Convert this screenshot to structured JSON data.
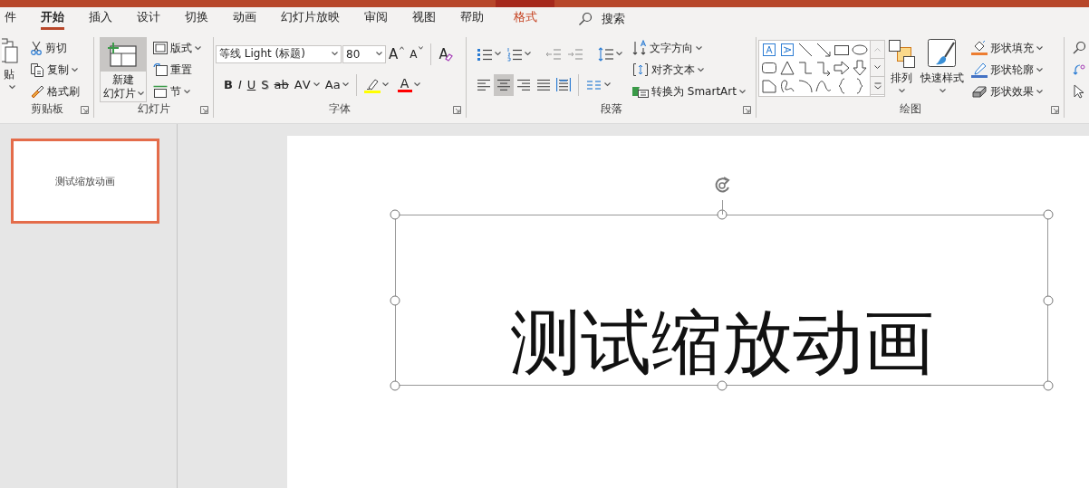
{
  "tabs": [
    {
      "label": "件",
      "selected": false,
      "kind": "standard"
    },
    {
      "label": "开始",
      "selected": true,
      "kind": "standard"
    },
    {
      "label": "插入",
      "selected": false,
      "kind": "standard"
    },
    {
      "label": "设计",
      "selected": false,
      "kind": "standard"
    },
    {
      "label": "切换",
      "selected": false,
      "kind": "standard"
    },
    {
      "label": "动画",
      "selected": false,
      "kind": "standard"
    },
    {
      "label": "幻灯片放映",
      "selected": false,
      "kind": "standard"
    },
    {
      "label": "审阅",
      "selected": false,
      "kind": "standard"
    },
    {
      "label": "视图",
      "selected": false,
      "kind": "standard"
    },
    {
      "label": "帮助",
      "selected": false,
      "kind": "standard"
    },
    {
      "label": "格式",
      "selected": false,
      "kind": "contextual"
    }
  ],
  "search": {
    "label": "搜索"
  },
  "ribbon": {
    "clipboard": {
      "title": "剪贴板",
      "paste": "贴",
      "cut": "剪切",
      "copy": "复制",
      "format_painter": "格式刷"
    },
    "slides": {
      "title": "幻灯片",
      "new_slide": [
        "新建",
        "幻灯片"
      ],
      "layout": "版式",
      "reset": "重置",
      "section": "节"
    },
    "font": {
      "title": "字体",
      "font_name": "等线 Light (标题)",
      "font_size": "80",
      "grow": "A",
      "shrink": "A",
      "clear": "A",
      "styles": [
        "B",
        "I",
        "U",
        "S",
        "ab",
        "AV",
        "Aa"
      ],
      "font_color": "A"
    },
    "paragraph": {
      "title": "段落",
      "alignments": [
        {
          "kind": "left",
          "selected": false
        },
        {
          "kind": "center",
          "selected": true
        },
        {
          "kind": "right",
          "selected": false
        },
        {
          "kind": "justify",
          "selected": false
        },
        {
          "kind": "distributed",
          "selected": false
        }
      ],
      "text_direction": "文字方向",
      "align_text": "对齐文本",
      "smartart": "转换为 SmartArt"
    },
    "drawing": {
      "title": "绘图",
      "arrange": "排列",
      "quick_styles": "快速样式",
      "fill": "形状填充",
      "outline": "形状轮廓",
      "effects": "形状效果"
    }
  },
  "thumbnails": [
    {
      "text": "测试缩放动画",
      "selected": true
    }
  ],
  "slide": {
    "title": "测试缩放动画",
    "selected": true
  }
}
